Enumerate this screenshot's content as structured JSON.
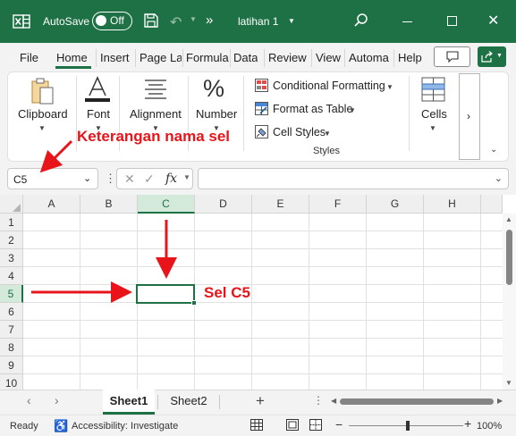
{
  "titlebar": {
    "autosave_label": "AutoSave",
    "autosave_state": "Off",
    "more_glyph": "»",
    "file_name": "latihan 1",
    "icons": [
      "excel-logo-icon",
      "save-icon",
      "undo-icon",
      "search-icon",
      "minimize-icon",
      "maximize-icon",
      "close-icon"
    ]
  },
  "tabs": [
    "File",
    "Home",
    "Insert",
    "Page La",
    "Formula",
    "Data",
    "Review",
    "View",
    "Automa",
    "Help"
  ],
  "active_tab": "Home",
  "ribbon": {
    "clipboard": "Clipboard",
    "font": "Font",
    "alignment": "Alignment",
    "number": "Number",
    "conditional_formatting": "Conditional Formatting",
    "format_as_table": "Format as Table",
    "cell_styles": "Cell Styles",
    "styles_group": "Styles",
    "cells": "Cells",
    "more": "›"
  },
  "formula_bar": {
    "name_box": "C5",
    "dots": "⋮",
    "cancel": "✕",
    "enter": "✓",
    "fx": "fx",
    "formula": ""
  },
  "grid": {
    "columns": [
      "A",
      "B",
      "C",
      "D",
      "E",
      "F",
      "G",
      "H"
    ],
    "rows": [
      "1",
      "2",
      "3",
      "4",
      "5",
      "6",
      "7",
      "8",
      "9",
      "10"
    ],
    "selected_column": "C",
    "selected_row": "5",
    "selected_cell": "C5"
  },
  "sheets": {
    "nav_prev": "‹",
    "nav_next": "›",
    "tabs": [
      "Sheet1",
      "Sheet2"
    ],
    "active": "Sheet1",
    "add": "+",
    "dots": "⋮"
  },
  "status": {
    "ready": "Ready",
    "accessibility": "Accessibility: Investigate",
    "zoom_minus": "−",
    "zoom_plus": "+",
    "zoom": "100%",
    "zoom_level_percent": 100
  },
  "annotations": {
    "name_box_label": "Keterangan nama sel",
    "cell_label": "Sel C5"
  },
  "colors": {
    "excel_green": "#1e7145",
    "annotation_red": "#e8141a",
    "selection_fill": "#d3e9da"
  }
}
